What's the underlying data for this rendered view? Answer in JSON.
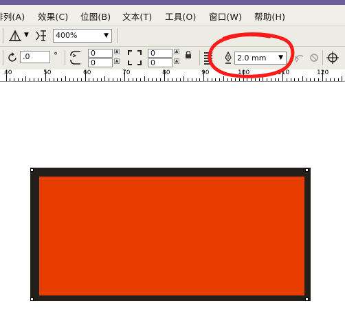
{
  "menubar": {
    "items": [
      "排列(A)",
      "效果(C)",
      "位图(B)",
      "文本(T)",
      "工具(O)",
      "窗口(W)",
      "帮助(H)"
    ]
  },
  "toolbar1": {
    "zoom_value": "400%"
  },
  "toolbar2": {
    "rotation_value": ".0",
    "degree_symbol": "°",
    "corner_values": [
      "0",
      "0",
      "0",
      "0"
    ],
    "outline_width": "2.0 mm"
  },
  "ruler": {
    "labels": [
      "40",
      "50",
      "60",
      "70",
      "80",
      "90",
      "100",
      "110",
      "120"
    ]
  },
  "colors": {
    "fill": "#e83d00",
    "outline": "#231f1a",
    "annotation": "#ff1a1a"
  },
  "icons": [
    "align-icon",
    "symmetric-icon",
    "rotate-icon",
    "round-corners-icon",
    "corner-bracket-icon",
    "lock-icon",
    "outline-pen-icon",
    "convert-to-curves-icon",
    "wrap-text-icon",
    "target-icon"
  ]
}
